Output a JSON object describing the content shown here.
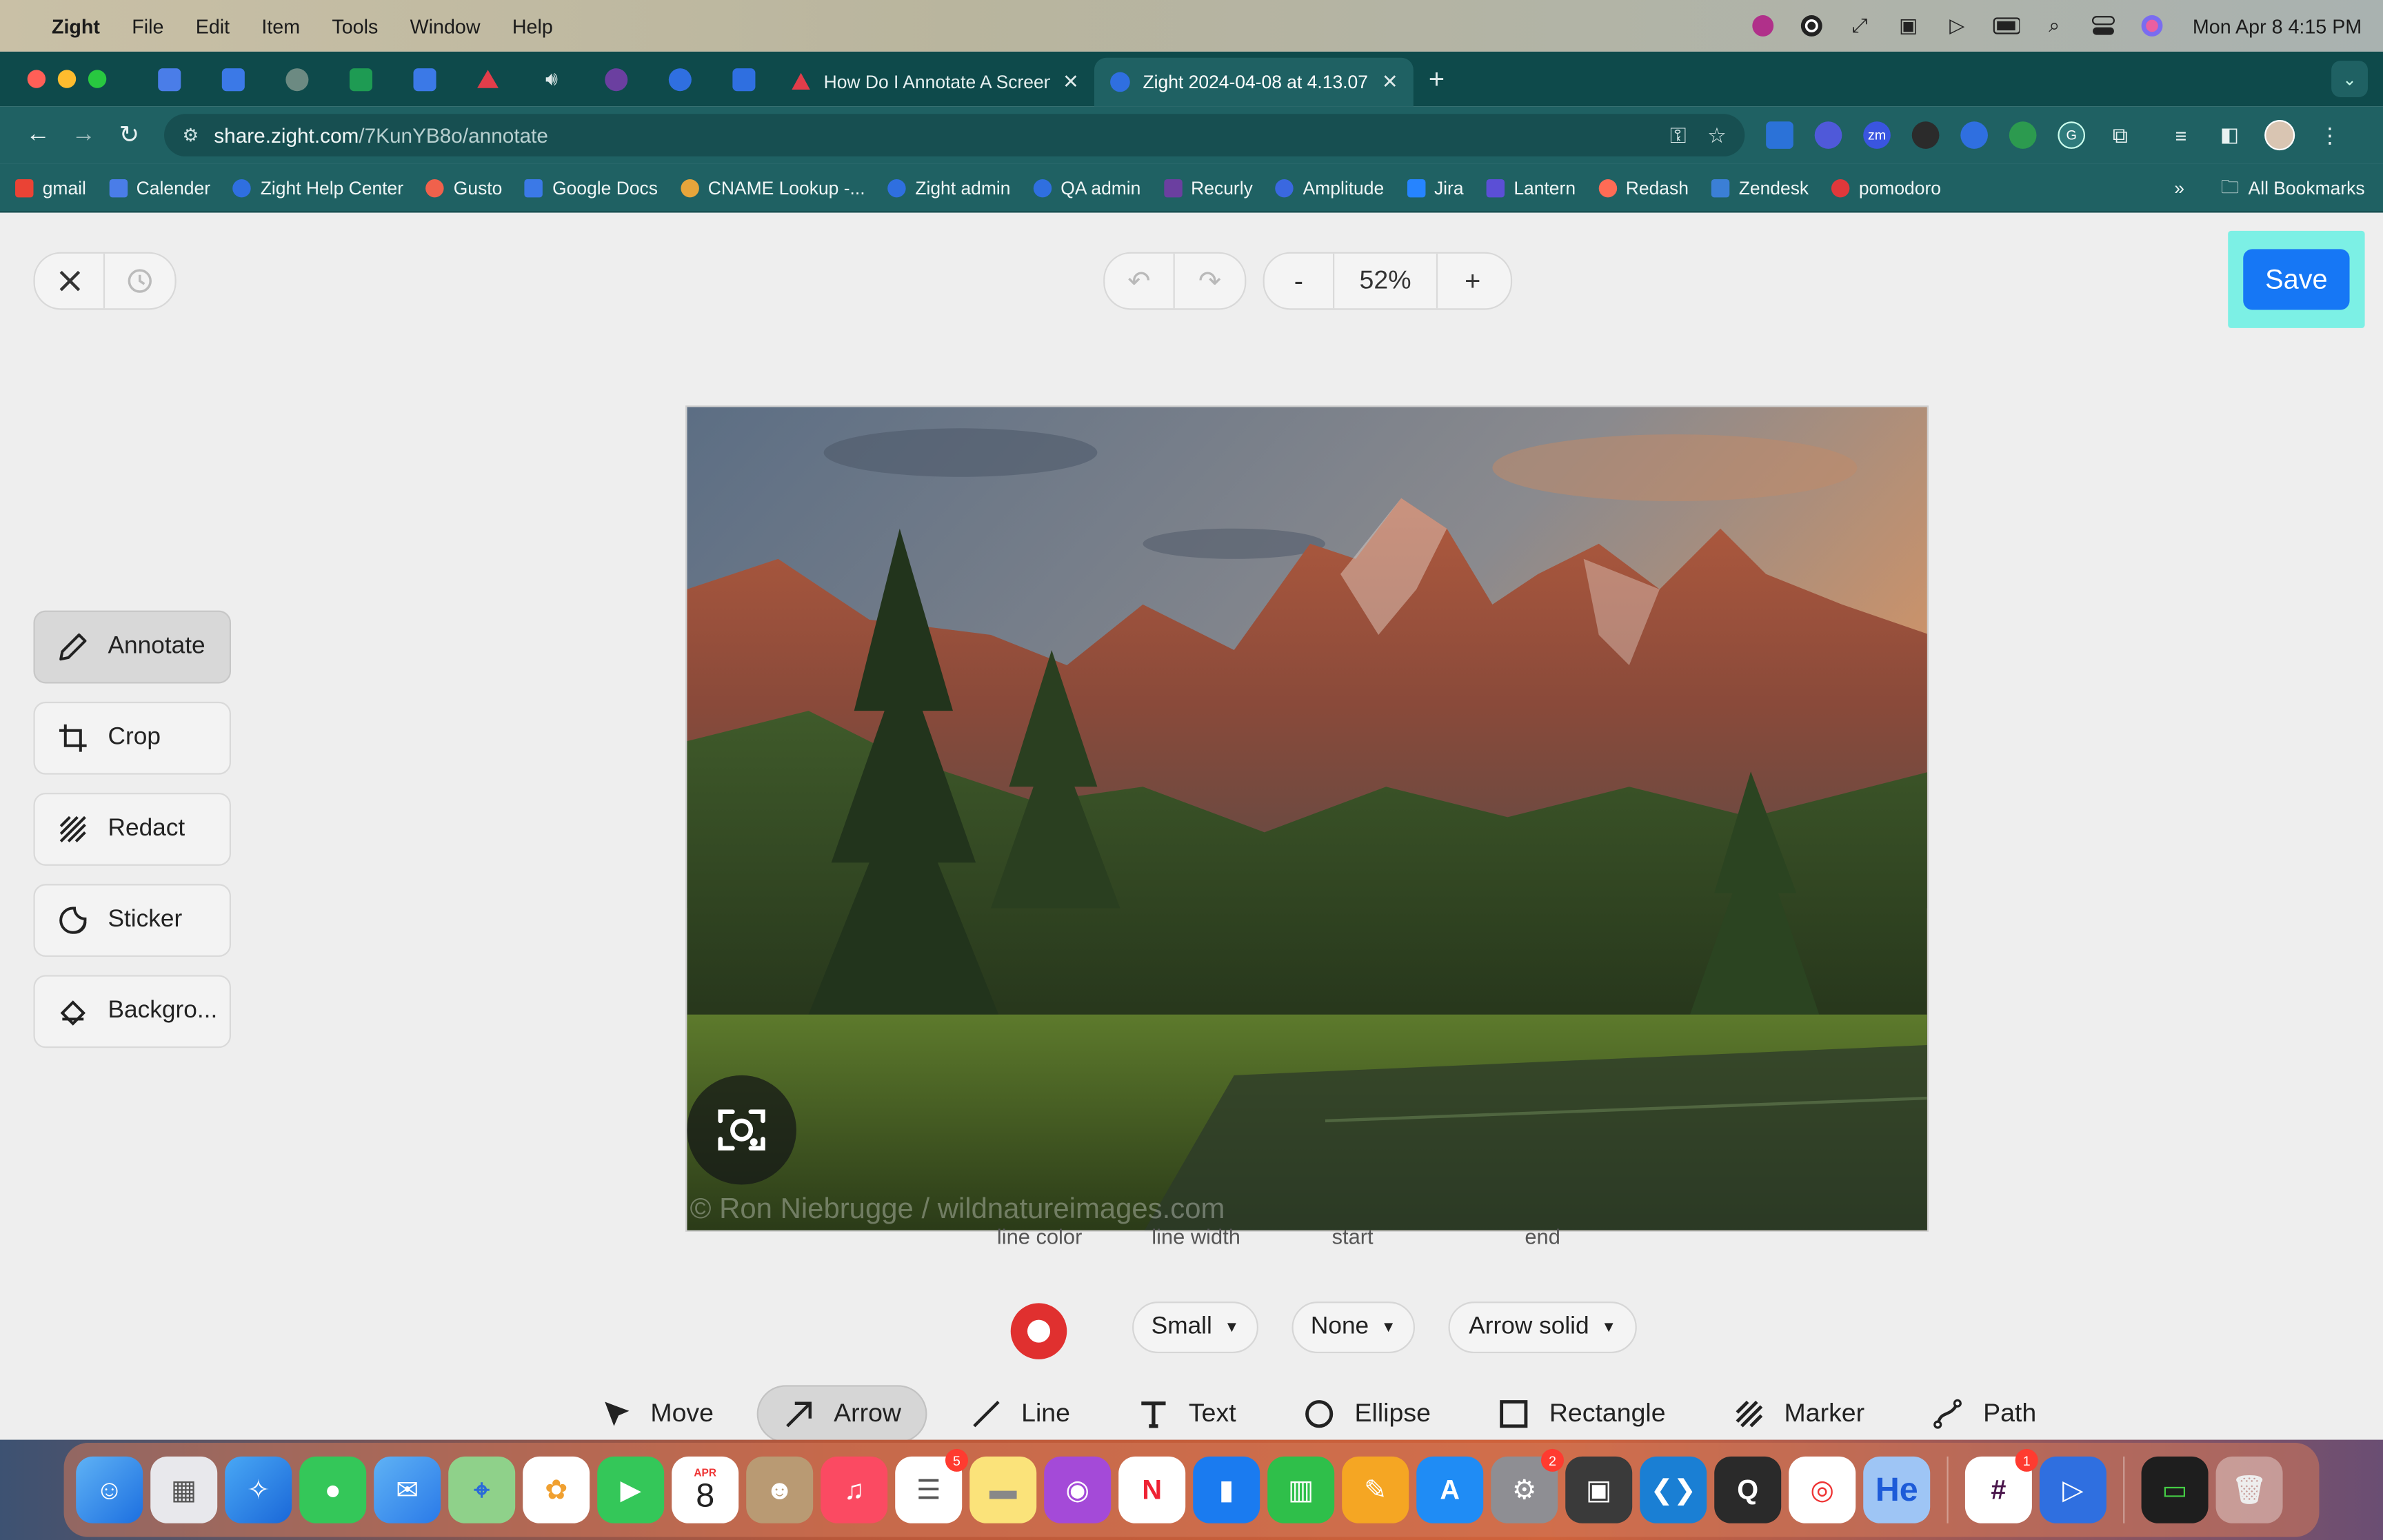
{
  "menubar": {
    "app_name": "Zight",
    "items": [
      "File",
      "Edit",
      "Item",
      "Tools",
      "Window",
      "Help"
    ],
    "clock": "Mon Apr 8  4:15 PM"
  },
  "browser": {
    "tabs": [
      {
        "title": "How Do I Annotate A Screens",
        "active": false
      },
      {
        "title": "Zight 2024-04-08 at 4.13.07",
        "active": true
      }
    ],
    "url_host": "share.zight.com",
    "url_path": "/7KunYB8o/annotate",
    "bookmarks": [
      "gmail",
      "Calender",
      "Zight Help Center",
      "Gusto",
      "Google Docs",
      "CNAME Lookup -...",
      "Zight admin",
      "QA admin",
      "Recurly",
      "Amplitude",
      "Jira",
      "Lantern",
      "Redash",
      "Zendesk",
      "pomodoro"
    ],
    "all_bookmarks": "All Bookmarks"
  },
  "editor": {
    "zoom": "52%",
    "zoom_minus": "-",
    "zoom_plus": "+",
    "save_label": "Save",
    "side_tools": [
      {
        "label": "Annotate",
        "icon": "pencil-icon",
        "active": true
      },
      {
        "label": "Crop",
        "icon": "crop-icon",
        "active": false
      },
      {
        "label": "Redact",
        "icon": "redact-icon",
        "active": false
      },
      {
        "label": "Sticker",
        "icon": "sticker-icon",
        "active": false
      },
      {
        "label": "Backgro...",
        "icon": "background-icon",
        "active": false
      }
    ],
    "image_watermark": "© Ron Niebrugge / wildnatureimages.com",
    "properties": {
      "line_color_label": "line color",
      "line_color": "#e0302f",
      "line_width_label": "line width",
      "line_width": "Small",
      "start_label": "start",
      "start": "None",
      "end_label": "end",
      "end": "Arrow solid"
    },
    "draw_tools": [
      {
        "label": "Move",
        "icon": "cursor-icon",
        "active": false
      },
      {
        "label": "Arrow",
        "icon": "arrow-icon",
        "active": true
      },
      {
        "label": "Line",
        "icon": "line-icon",
        "active": false
      },
      {
        "label": "Text",
        "icon": "text-icon",
        "active": false
      },
      {
        "label": "Ellipse",
        "icon": "ellipse-icon",
        "active": false
      },
      {
        "label": "Rectangle",
        "icon": "rectangle-icon",
        "active": false
      },
      {
        "label": "Marker",
        "icon": "marker-icon",
        "active": false
      },
      {
        "label": "Path",
        "icon": "path-icon",
        "active": false
      }
    ]
  },
  "dock": {
    "calendar_month": "APR",
    "calendar_day": "8",
    "badges": {
      "reminders": "5",
      "settings": "2",
      "slack": "1"
    },
    "hey_label": "He"
  },
  "colors": {
    "accent": "#1677f5",
    "highlight": "#7cf0e5",
    "chrome": "#1f6163"
  }
}
